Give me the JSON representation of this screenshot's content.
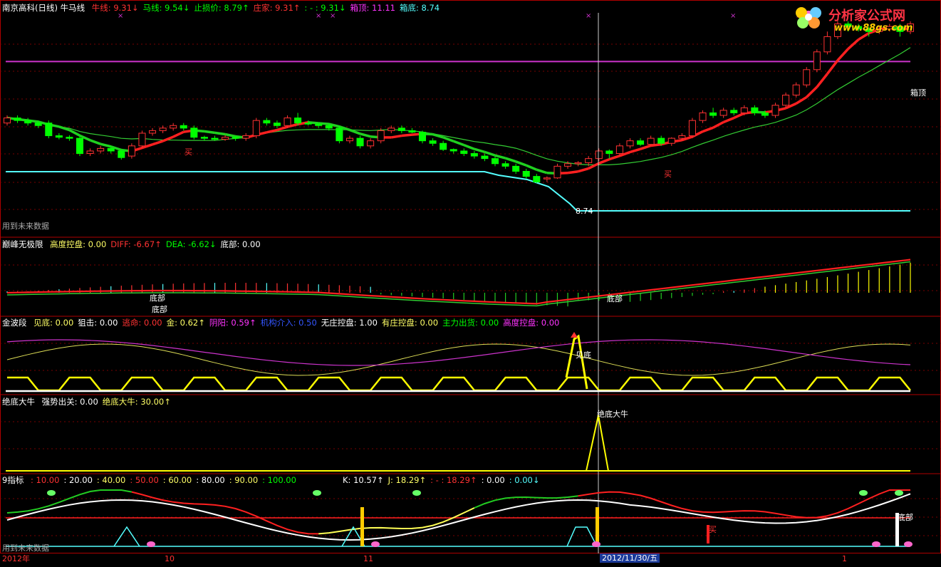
{
  "colors": {
    "up": "#ff3232",
    "down": "#00ff00",
    "grid": "#7a0000",
    "white": "#ffffff",
    "yellow": "#ffff00",
    "cyan": "#54ffff",
    "magenta": "#ff00ff",
    "green": "#00e000",
    "red": "#ff1a1a",
    "purple": "#cc33cc",
    "blue": "#3355ff"
  },
  "pane1": {
    "title": "南京高科(日线) 牛马线",
    "items": [
      {
        "label": "牛线: 9.31",
        "arrow": "↓",
        "color": "#ff3232"
      },
      {
        "label": "马线: 9.54",
        "arrow": "↓",
        "color": "#00ff00"
      },
      {
        "label": "止损价: 8.79",
        "arrow": "↑",
        "color": "#00ff00"
      },
      {
        "label": "庄家: 9.31",
        "arrow": "↑",
        "color": "#ff3232"
      },
      {
        "label": ": - : 9.31",
        "arrow": "↓",
        "color": "#00ff00"
      },
      {
        "label": "箱顶: 11.11",
        "arrow": "",
        "color": "#ff33ff"
      },
      {
        "label": "箱底: 8.74",
        "arrow": "",
        "color": "#54ffff"
      }
    ],
    "box_top_label": "箱顶",
    "future_note": "用到未来数据",
    "low_price": "8.74",
    "buy_label": "买",
    "stop_label": "买"
  },
  "pane2": {
    "title": "巅峰无极限",
    "items": [
      {
        "label": "高度控盘: 0.00",
        "arrow": "",
        "color": "#ffff66"
      },
      {
        "label": "DIFF: -6.67",
        "arrow": "↑",
        "color": "#ff3232"
      },
      {
        "label": "DEA: -6.62",
        "arrow": "↓",
        "color": "#00ff00"
      },
      {
        "label": "底部: 0.00",
        "arrow": "",
        "color": "#ffffff"
      }
    ],
    "bottom_labels": [
      "底部",
      "底部",
      "底部"
    ]
  },
  "pane3": {
    "title": "金波段",
    "items": [
      {
        "label": "见底: 0.00",
        "arrow": "",
        "color": "#ffff66"
      },
      {
        "label": "狙击: 0.00",
        "arrow": "",
        "color": "#ffffff"
      },
      {
        "label": "逃命: 0.00",
        "arrow": "",
        "color": "#ff3232"
      },
      {
        "label": "金: 0.62",
        "arrow": "↑",
        "color": "#ffff66"
      },
      {
        "label": "阴阳: 0.59",
        "arrow": "↑",
        "color": "#ff33ff"
      },
      {
        "label": "机构介入: 0.50",
        "arrow": "",
        "color": "#3355ff"
      },
      {
        "label": "无庄控盘: 1.00",
        "arrow": "",
        "color": "#ffffff"
      },
      {
        "label": "有庄控盘: 0.00",
        "arrow": "",
        "color": "#ffff66"
      },
      {
        "label": "主力出货: 0.00",
        "arrow": "",
        "color": "#00ff00"
      },
      {
        "label": "高度控盘: 0.00",
        "arrow": "",
        "color": "#ff33ff"
      }
    ],
    "signal_label": "见底"
  },
  "pane4": {
    "title": "绝底大牛",
    "items": [
      {
        "label": "强势出关: 0.00",
        "arrow": "",
        "color": "#ffffff"
      },
      {
        "label": "绝底大牛: 30.00",
        "arrow": "↑",
        "color": "#ffff66"
      }
    ],
    "signal_label": "绝底大牛"
  },
  "pane5": {
    "title": "9指标",
    "levels": [
      {
        "label": ": 10.00",
        "color": "#ff3232"
      },
      {
        "label": ": 20.00",
        "color": "#ffffff"
      },
      {
        "label": ": 40.00",
        "color": "#ffff66"
      },
      {
        "label": ": 50.00",
        "color": "#ff3232"
      },
      {
        "label": ": 60.00",
        "color": "#ffff66"
      },
      {
        "label": ": 80.00",
        "color": "#ffffff"
      },
      {
        "label": ": 90.00",
        "color": "#ffff66"
      },
      {
        "label": ": 100.00",
        "color": "#00ff00"
      }
    ],
    "items": [
      {
        "label": "K: 10.57",
        "arrow": "↑",
        "color": "#ffffff"
      },
      {
        "label": "J: 18.29",
        "arrow": "↑",
        "color": "#ffff66"
      },
      {
        "label": ": - : 18.29",
        "arrow": "↑",
        "color": "#ff3232"
      },
      {
        "label": ": 0.00",
        "arrow": "",
        "color": "#ffffff"
      },
      {
        "label": ": 0.00",
        "arrow": "↓",
        "color": "#54ffff"
      }
    ],
    "bottom_label": "底部",
    "buy_label": "买",
    "future_note": "用到未来数据"
  },
  "dates": {
    "labels": [
      "2012年",
      "10",
      "11",
      "1"
    ],
    "cursor_date": "2012/11/30/五"
  },
  "watermark": {
    "title": "分析家公式网",
    "url": "www.88gs.com"
  },
  "chart_data": {
    "type": "candlestick",
    "title": "南京高科(日线) 牛马线",
    "ylim": [
      8.2,
      11.9
    ],
    "box_top": 11.11,
    "box_bottom": 8.74,
    "candles": [
      [
        9.9,
        10.0,
        9.85,
        10.05
      ],
      [
        10.0,
        9.95,
        9.9,
        10.05
      ],
      [
        9.95,
        9.9,
        9.85,
        10.0
      ],
      [
        9.9,
        9.85,
        9.8,
        9.95
      ],
      [
        9.9,
        9.65,
        9.6,
        9.95
      ],
      [
        9.65,
        9.62,
        9.58,
        9.7
      ],
      [
        9.62,
        9.6,
        9.55,
        9.66
      ],
      [
        9.6,
        9.3,
        9.25,
        9.65
      ],
      [
        9.3,
        9.35,
        9.25,
        9.4
      ],
      [
        9.35,
        9.4,
        9.3,
        9.45
      ],
      [
        9.4,
        9.35,
        9.3,
        9.45
      ],
      [
        9.35,
        9.22,
        9.18,
        9.38
      ],
      [
        9.25,
        9.45,
        9.2,
        9.5
      ],
      [
        9.45,
        9.7,
        9.4,
        9.75
      ],
      [
        9.7,
        9.75,
        9.65,
        9.8
      ],
      [
        9.75,
        9.8,
        9.7,
        9.85
      ],
      [
        9.8,
        9.85,
        9.75,
        9.9
      ],
      [
        9.85,
        9.8,
        9.75,
        9.9
      ],
      [
        9.8,
        9.62,
        9.58,
        9.85
      ],
      [
        9.62,
        9.6,
        9.55,
        9.65
      ],
      [
        9.6,
        9.58,
        9.55,
        9.65
      ],
      [
        9.58,
        9.62,
        9.55,
        9.66
      ],
      [
        9.62,
        9.6,
        9.55,
        9.65
      ],
      [
        9.6,
        9.65,
        9.55,
        9.7
      ],
      [
        9.65,
        9.95,
        9.6,
        10.0
      ],
      [
        9.95,
        9.9,
        9.85,
        10.0
      ],
      [
        9.9,
        9.85,
        9.8,
        9.95
      ],
      [
        9.85,
        10.0,
        9.8,
        10.05
      ],
      [
        10.0,
        9.9,
        9.85,
        10.1
      ],
      [
        9.9,
        9.88,
        9.85,
        9.95
      ],
      [
        9.88,
        9.85,
        9.8,
        9.9
      ],
      [
        9.85,
        9.8,
        9.75,
        9.9
      ],
      [
        9.8,
        9.55,
        9.5,
        9.85
      ],
      [
        9.55,
        9.6,
        9.5,
        9.65
      ],
      [
        9.6,
        9.45,
        9.4,
        9.65
      ],
      [
        9.45,
        9.55,
        9.4,
        9.6
      ],
      [
        9.55,
        9.75,
        9.5,
        9.8
      ],
      [
        9.75,
        9.8,
        9.7,
        9.85
      ],
      [
        9.8,
        9.75,
        9.7,
        9.85
      ],
      [
        9.75,
        9.72,
        9.7,
        9.8
      ],
      [
        9.72,
        9.55,
        9.5,
        9.75
      ],
      [
        9.55,
        9.5,
        9.45,
        9.6
      ],
      [
        9.5,
        9.38,
        9.35,
        9.55
      ],
      [
        9.38,
        9.35,
        9.3,
        9.4
      ],
      [
        9.35,
        9.3,
        9.25,
        9.4
      ],
      [
        9.3,
        9.25,
        9.2,
        9.35
      ],
      [
        9.25,
        9.2,
        9.15,
        9.3
      ],
      [
        9.2,
        9.1,
        9.05,
        9.25
      ],
      [
        9.1,
        9.05,
        9.0,
        9.15
      ],
      [
        9.05,
        8.95,
        8.9,
        9.1
      ],
      [
        8.95,
        8.85,
        8.8,
        9.0
      ],
      [
        8.85,
        8.74,
        8.72,
        8.9
      ],
      [
        8.8,
        8.82,
        8.74,
        8.85
      ],
      [
        8.82,
        9.05,
        8.8,
        9.1
      ],
      [
        9.05,
        9.1,
        9.0,
        9.15
      ],
      [
        9.1,
        9.12,
        9.05,
        9.15
      ],
      [
        9.12,
        9.2,
        9.05,
        9.25
      ],
      [
        9.2,
        9.35,
        9.15,
        9.4
      ],
      [
        9.35,
        9.3,
        9.2,
        9.38
      ],
      [
        9.3,
        9.45,
        9.25,
        9.5
      ],
      [
        9.45,
        9.55,
        9.4,
        9.6
      ],
      [
        9.55,
        9.48,
        9.45,
        9.6
      ],
      [
        9.48,
        9.6,
        9.45,
        9.65
      ],
      [
        9.6,
        9.5,
        9.45,
        9.65
      ],
      [
        9.5,
        9.6,
        9.45,
        9.62
      ],
      [
        9.6,
        9.65,
        9.55,
        9.7
      ],
      [
        9.65,
        9.95,
        9.6,
        10.0
      ],
      [
        9.95,
        10.1,
        9.9,
        10.15
      ],
      [
        10.1,
        10.05,
        10.0,
        10.2
      ],
      [
        10.05,
        10.15,
        10.0,
        10.2
      ],
      [
        10.15,
        10.1,
        10.05,
        10.2
      ],
      [
        10.1,
        10.2,
        10.05,
        10.25
      ],
      [
        10.2,
        10.1,
        10.05,
        10.25
      ],
      [
        10.1,
        10.05,
        10.0,
        10.15
      ],
      [
        10.05,
        10.25,
        10.0,
        10.3
      ],
      [
        10.25,
        10.45,
        10.2,
        10.5
      ],
      [
        10.45,
        10.65,
        10.4,
        10.7
      ],
      [
        10.65,
        10.95,
        10.6,
        11.0
      ],
      [
        10.95,
        11.3,
        10.9,
        11.35
      ],
      [
        11.3,
        11.6,
        11.25,
        11.7
      ],
      [
        11.6,
        11.85,
        11.55,
        11.9
      ],
      [
        11.85,
        11.8,
        11.7,
        11.9
      ],
      [
        11.8,
        11.75,
        11.7,
        11.85
      ],
      [
        11.75,
        11.7,
        11.6,
        11.8
      ],
      [
        11.7,
        11.75,
        11.65,
        11.8
      ],
      [
        11.75,
        11.8,
        11.7,
        11.85
      ],
      [
        11.8,
        11.7,
        11.6,
        11.85
      ],
      [
        11.7,
        11.85,
        11.65,
        11.9
      ]
    ]
  }
}
